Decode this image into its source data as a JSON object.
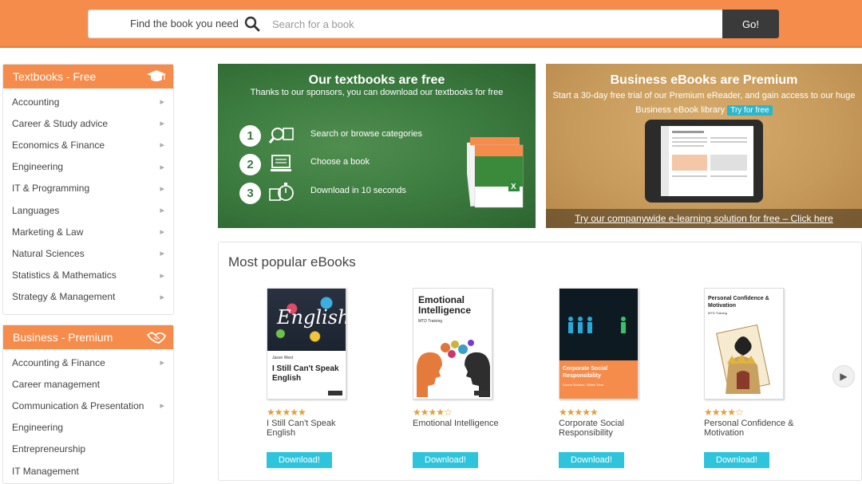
{
  "search": {
    "prompt": "Find the book you need",
    "placeholder": "Search for a book",
    "go_label": "Go!"
  },
  "sidebar_free": {
    "title": "Textbooks - Free",
    "icon": "graduation-cap-icon",
    "items": [
      {
        "label": "Accounting",
        "has_arrow": true
      },
      {
        "label": "Career & Study advice",
        "has_arrow": true
      },
      {
        "label": "Economics & Finance",
        "has_arrow": true
      },
      {
        "label": "Engineering",
        "has_arrow": true
      },
      {
        "label": "IT & Programming",
        "has_arrow": true
      },
      {
        "label": "Languages",
        "has_arrow": true
      },
      {
        "label": "Marketing & Law",
        "has_arrow": true
      },
      {
        "label": "Natural Sciences",
        "has_arrow": true
      },
      {
        "label": "Statistics & Mathematics",
        "has_arrow": true
      },
      {
        "label": "Strategy & Management",
        "has_arrow": true
      }
    ]
  },
  "sidebar_premium": {
    "title": "Business - Premium",
    "icon": "handshake-icon",
    "items": [
      {
        "label": "Accounting & Finance",
        "has_arrow": true
      },
      {
        "label": "Career management",
        "has_arrow": false
      },
      {
        "label": "Communication & Presentation",
        "has_arrow": true
      },
      {
        "label": "Engineering",
        "has_arrow": false
      },
      {
        "label": "Entrepreneurship",
        "has_arrow": false
      },
      {
        "label": "IT Management",
        "has_arrow": false
      }
    ]
  },
  "promo_free": {
    "title": "Our textbooks are free",
    "subtitle": "Thanks to our sponsors, you can download our textbooks for free",
    "steps": [
      {
        "num": "1",
        "text": "Search or browse categories",
        "icon": "magnifier-book-icon"
      },
      {
        "num": "2",
        "text": "Choose a book",
        "icon": "computer-screen-icon"
      },
      {
        "num": "3",
        "text": "Download in 10 seconds",
        "icon": "stopwatch-book-icon"
      }
    ]
  },
  "promo_premium": {
    "title": "Business eBooks are Premium",
    "line1": "Start a 30-day free trial of our Premium eReader, and gain access to our huge",
    "line2": "Business eBook library",
    "try_label": "Try for free",
    "cta": "Try our companywide e-learning solution for free – Click here"
  },
  "popular": {
    "title": "Most popular eBooks",
    "download_label": "Download!",
    "books": [
      {
        "name": "I Still Can't Speak English",
        "cover_author": "Jason West",
        "cover_title": "I Still Can't Speak English",
        "cover_word": "English",
        "rating": 5
      },
      {
        "name": "Emotional Intelligence",
        "cover_title": "Emotional Intelligence",
        "cover_author": "MTD Training",
        "rating": 4.5
      },
      {
        "name": "Corporate Social Responsibility",
        "cover_title": "Corporate Social Responsibility",
        "cover_author": "Duane Windsor, Gilbert Tana",
        "rating": 5
      },
      {
        "name": "Personal Confidence & Motivation",
        "cover_title": "Personal Confidence & Motivation",
        "cover_author": "MTD Training",
        "rating": 4.5
      }
    ]
  }
}
